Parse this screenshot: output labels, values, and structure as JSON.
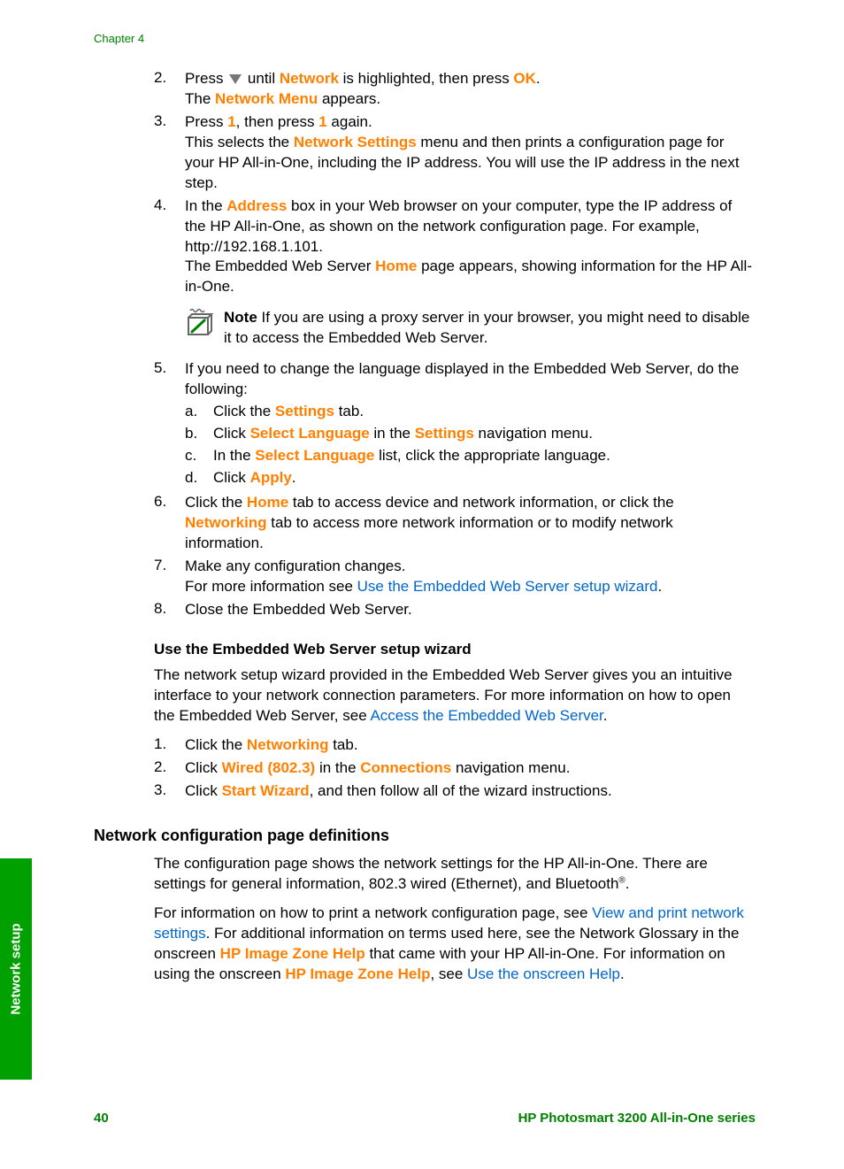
{
  "chapter": "Chapter 4",
  "sideTab": "Network setup",
  "pageNumber": "40",
  "product": "HP Photosmart 3200 All-in-One series",
  "list1": {
    "i2": {
      "num": "2.",
      "t1": "Press ",
      "t2": " until ",
      "network": "Network",
      "t3": " is highlighted, then press ",
      "ok": "OK",
      "t4": ".",
      "line2a": "The ",
      "networkMenu": "Network Menu",
      "line2b": " appears."
    },
    "i3": {
      "num": "3.",
      "t1": "Press ",
      "one1": "1",
      "t2": ", then press ",
      "one2": "1",
      "t3": " again.",
      "line2a": "This selects the ",
      "ns": "Network Settings",
      "line2b": " menu and then prints a configuration page for your HP All-in-One, including the IP address. You will use the IP address in the next step."
    },
    "i4": {
      "num": "4.",
      "t1": "In the ",
      "address": "Address",
      "t2": " box in your Web browser on your computer, type the IP address of the HP All-in-One, as shown on the network configuration page. For example, http://192.168.1.101.",
      "line2a": "The Embedded Web Server ",
      "home": "Home",
      "line2b": " page appears, showing information for the HP All-in-One."
    },
    "note": {
      "label": "Note",
      "text": "  If you are using a proxy server in your browser, you might need to disable it to access the Embedded Web Server."
    },
    "i5": {
      "num": "5.",
      "t1": "If you need to change the language displayed in the Embedded Web Server, do the following:",
      "a": {
        "letter": "a.",
        "t1": "Click the ",
        "settings": "Settings",
        "t2": " tab."
      },
      "b": {
        "letter": "b.",
        "t1": "Click ",
        "sl": "Select Language",
        "t2": " in the ",
        "settings": "Settings",
        "t3": " navigation menu."
      },
      "c": {
        "letter": "c.",
        "t1": "In the ",
        "sl": "Select Language",
        "t2": " list, click the appropriate language."
      },
      "d": {
        "letter": "d.",
        "t1": "Click ",
        "apply": "Apply",
        "t2": "."
      }
    },
    "i6": {
      "num": "6.",
      "t1": "Click the ",
      "home": "Home",
      "t2": " tab to access device and network information, or click the ",
      "networking": "Networking",
      "t3": " tab to access more network information or to modify network information."
    },
    "i7": {
      "num": "7.",
      "t1": "Make any configuration changes.",
      "line2a": "For more information see ",
      "link": "Use the Embedded Web Server setup wizard",
      "line2b": "."
    },
    "i8": {
      "num": "8.",
      "t1": "Close the Embedded Web Server."
    }
  },
  "heading1": "Use the Embedded Web Server setup wizard",
  "para1a": "The network setup wizard provided in the Embedded Web Server gives you an intuitive interface to your network connection parameters. For more information on how to open the Embedded Web Server, see ",
  "para1link": "Access the Embedded Web Server",
  "para1b": ".",
  "list2": {
    "i1": {
      "num": "1.",
      "t1": "Click the ",
      "networking": "Networking",
      "t2": " tab."
    },
    "i2": {
      "num": "2.",
      "t1": "Click ",
      "wired": "Wired (802.3)",
      "t2": " in the ",
      "conn": "Connections",
      "t3": " navigation menu."
    },
    "i3": {
      "num": "3.",
      "t1": "Click ",
      "sw": "Start Wizard",
      "t2": ", and then follow all of the wizard instructions."
    }
  },
  "sectionHeading": "Network configuration page definitions",
  "para2": "The configuration page shows the network settings for the HP All-in-One. There are settings for general information, 802.3 wired (Ethernet), and Bluetooth",
  "para2reg": "®",
  "para2end": ".",
  "para3a": "For information on how to print a network configuration page, see ",
  "para3link1": "View and print network settings",
  "para3b": ". For additional information on terms used here, see the Network Glossary in the onscreen ",
  "para3hp1": "HP Image Zone Help",
  "para3c": " that came with your HP All-in-One. For information on using the onscreen ",
  "para3hp2": "HP Image Zone Help",
  "para3d": ", see ",
  "para3link2": "Use the onscreen Help",
  "para3e": "."
}
